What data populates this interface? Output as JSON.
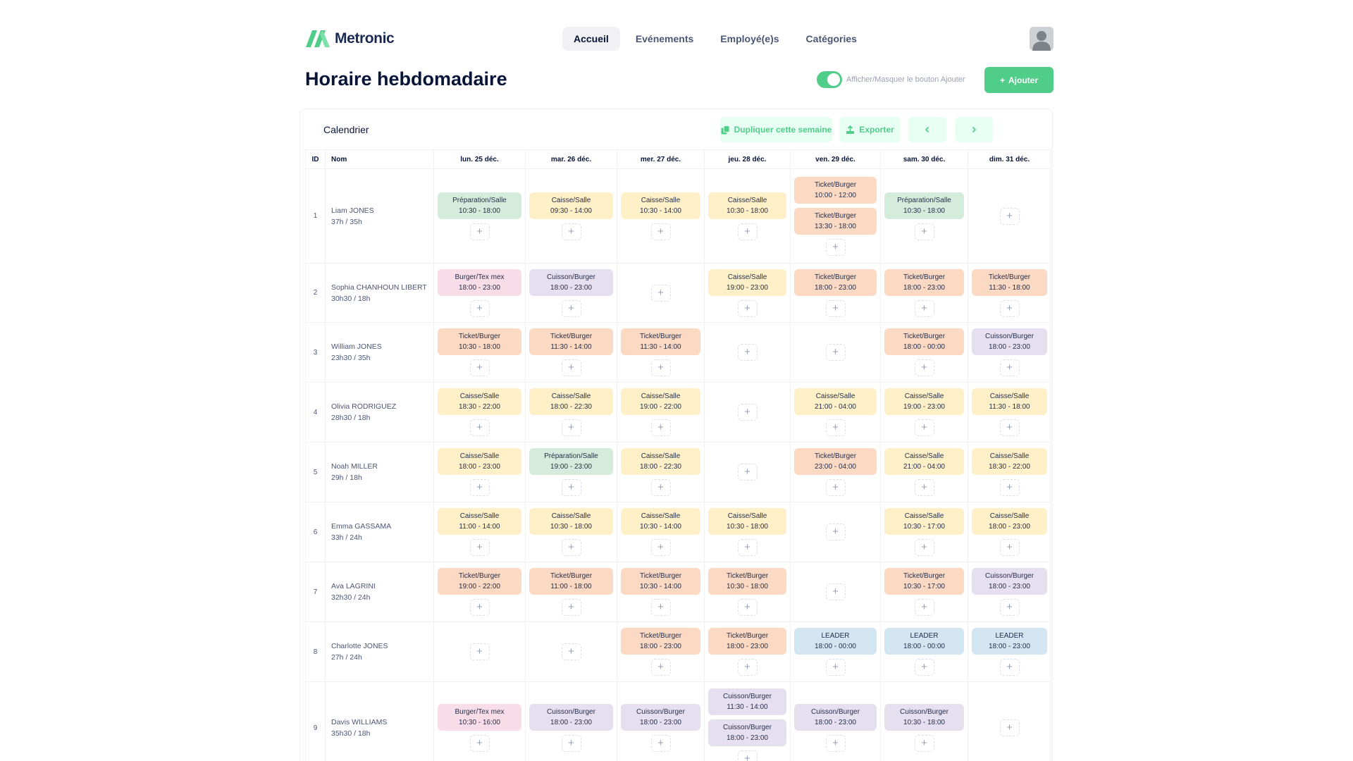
{
  "brand": {
    "name": "Metronic",
    "color": "#50cd89"
  },
  "nav": {
    "items": [
      {
        "label": "Accueil",
        "active": true
      },
      {
        "label": "Evénements",
        "active": false
      },
      {
        "label": "Employé(e)s",
        "active": false
      },
      {
        "label": "Catégories",
        "active": false
      }
    ]
  },
  "page": {
    "title": "Horaire hebdomadaire",
    "toggle_label": "Afficher/Masquer le bouton Ajouter",
    "toggle_on": true,
    "add_label": "Ajouter"
  },
  "calendar": {
    "title": "Calendrier",
    "duplicate_label": "Dupliquer cette semaine",
    "export_label": "Exporter",
    "prev_icon": "chevron-left-icon",
    "next_icon": "chevron-right-icon"
  },
  "table": {
    "col_id": "ID",
    "col_name": "Nom",
    "days": [
      "lun. 25 déc.",
      "mar. 26 déc.",
      "mer. 27 déc.",
      "jeu. 28 déc.",
      "ven. 29 déc.",
      "sam. 30 déc.",
      "dim. 31 déc."
    ],
    "rows": [
      {
        "id": "1",
        "name": "Liam JONES",
        "hours": "37h / 35h",
        "days": [
          [
            {
              "cat": "Préparation/Salle",
              "time": "10:30 - 18:00",
              "kind": "prep"
            }
          ],
          [
            {
              "cat": "Caisse/Salle",
              "time": "09:30 - 14:00",
              "kind": "caisse"
            }
          ],
          [
            {
              "cat": "Caisse/Salle",
              "time": "10:30 - 14:00",
              "kind": "caisse"
            }
          ],
          [
            {
              "cat": "Caisse/Salle",
              "time": "10:30 - 18:00",
              "kind": "caisse"
            }
          ],
          [
            {
              "cat": "Ticket/Burger",
              "time": "10:00 - 12:00",
              "kind": "ticket"
            },
            {
              "cat": "Ticket/Burger",
              "time": "13:30 - 18:00",
              "kind": "ticket"
            }
          ],
          [
            {
              "cat": "Préparation/Salle",
              "time": "10:30 - 18:00",
              "kind": "prep"
            }
          ],
          []
        ]
      },
      {
        "id": "2",
        "name": "Sophia CHANHOUN LIBERT",
        "hours": "30h30 / 18h",
        "days": [
          [
            {
              "cat": "Burger/Tex mex",
              "time": "18:00 - 23:00",
              "kind": "burgertex"
            }
          ],
          [
            {
              "cat": "Cuisson/Burger",
              "time": "18:00 - 23:00",
              "kind": "cuisson"
            }
          ],
          [],
          [
            {
              "cat": "Caisse/Salle",
              "time": "19:00 - 23:00",
              "kind": "caisse"
            }
          ],
          [
            {
              "cat": "Ticket/Burger",
              "time": "18:00 - 23:00",
              "kind": "ticket"
            }
          ],
          [
            {
              "cat": "Ticket/Burger",
              "time": "18:00 - 23:00",
              "kind": "ticket"
            }
          ],
          [
            {
              "cat": "Ticket/Burger",
              "time": "11:30 - 18:00",
              "kind": "ticket"
            }
          ]
        ]
      },
      {
        "id": "3",
        "name": "William JONES",
        "hours": "23h30 / 35h",
        "days": [
          [
            {
              "cat": "Ticket/Burger",
              "time": "10:30 - 18:00",
              "kind": "ticket"
            }
          ],
          [
            {
              "cat": "Ticket/Burger",
              "time": "11:30 - 14:00",
              "kind": "ticket"
            }
          ],
          [
            {
              "cat": "Ticket/Burger",
              "time": "11:30 - 14:00",
              "kind": "ticket"
            }
          ],
          [],
          [],
          [
            {
              "cat": "Ticket/Burger",
              "time": "18:00 - 00:00",
              "kind": "ticket"
            }
          ],
          [
            {
              "cat": "Cuisson/Burger",
              "time": "18:00 - 23:00",
              "kind": "cuisson"
            }
          ]
        ]
      },
      {
        "id": "4",
        "name": "Olivia RODRIGUEZ",
        "hours": "28h30 / 18h",
        "days": [
          [
            {
              "cat": "Caisse/Salle",
              "time": "18:30 - 22:00",
              "kind": "caisse"
            }
          ],
          [
            {
              "cat": "Caisse/Salle",
              "time": "18:00 - 22:30",
              "kind": "caisse"
            }
          ],
          [
            {
              "cat": "Caisse/Salle",
              "time": "19:00 - 22:00",
              "kind": "caisse"
            }
          ],
          [],
          [
            {
              "cat": "Caisse/Salle",
              "time": "21:00 - 04:00",
              "kind": "caisse"
            }
          ],
          [
            {
              "cat": "Caisse/Salle",
              "time": "19:00 - 23:00",
              "kind": "caisse"
            }
          ],
          [
            {
              "cat": "Caisse/Salle",
              "time": "11:30 - 18:00",
              "kind": "caisse"
            }
          ]
        ]
      },
      {
        "id": "5",
        "name": "Noah MILLER",
        "hours": "29h / 18h",
        "days": [
          [
            {
              "cat": "Caisse/Salle",
              "time": "18:00 - 23:00",
              "kind": "caisse"
            }
          ],
          [
            {
              "cat": "Préparation/Salle",
              "time": "19:00 - 23:00",
              "kind": "prep"
            }
          ],
          [
            {
              "cat": "Caisse/Salle",
              "time": "18:00 - 22:30",
              "kind": "caisse"
            }
          ],
          [],
          [
            {
              "cat": "Ticket/Burger",
              "time": "23:00 - 04:00",
              "kind": "ticket"
            }
          ],
          [
            {
              "cat": "Caisse/Salle",
              "time": "21:00 - 04:00",
              "kind": "caisse"
            }
          ],
          [
            {
              "cat": "Caisse/Salle",
              "time": "18:30 - 22:00",
              "kind": "caisse"
            }
          ]
        ]
      },
      {
        "id": "6",
        "name": "Emma GASSAMA",
        "hours": "33h / 24h",
        "days": [
          [
            {
              "cat": "Caisse/Salle",
              "time": "11:00 - 14:00",
              "kind": "caisse"
            }
          ],
          [
            {
              "cat": "Caisse/Salle",
              "time": "10:30 - 18:00",
              "kind": "caisse"
            }
          ],
          [
            {
              "cat": "Caisse/Salle",
              "time": "10:30 - 14:00",
              "kind": "caisse"
            }
          ],
          [
            {
              "cat": "Caisse/Salle",
              "time": "10:30 - 18:00",
              "kind": "caisse"
            }
          ],
          [],
          [
            {
              "cat": "Caisse/Salle",
              "time": "10:30 - 17:00",
              "kind": "caisse"
            }
          ],
          [
            {
              "cat": "Caisse/Salle",
              "time": "18:00 - 23:00",
              "kind": "caisse"
            }
          ]
        ]
      },
      {
        "id": "7",
        "name": "Ava LAGRINI",
        "hours": "32h30 / 24h",
        "days": [
          [
            {
              "cat": "Ticket/Burger",
              "time": "19:00 - 22:00",
              "kind": "ticket"
            }
          ],
          [
            {
              "cat": "Ticket/Burger",
              "time": "11:00 - 18:00",
              "kind": "ticket"
            }
          ],
          [
            {
              "cat": "Ticket/Burger",
              "time": "10:30 - 14:00",
              "kind": "ticket"
            }
          ],
          [
            {
              "cat": "Ticket/Burger",
              "time": "10:30 - 18:00",
              "kind": "ticket"
            }
          ],
          [],
          [
            {
              "cat": "Ticket/Burger",
              "time": "10:30 - 17:00",
              "kind": "ticket"
            }
          ],
          [
            {
              "cat": "Cuisson/Burger",
              "time": "18:00 - 23:00",
              "kind": "cuisson"
            }
          ]
        ]
      },
      {
        "id": "8",
        "name": "Charlotte JONES",
        "hours": "27h / 24h",
        "days": [
          [],
          [],
          [
            {
              "cat": "Ticket/Burger",
              "time": "18:00 - 23:00",
              "kind": "ticket"
            }
          ],
          [
            {
              "cat": "Ticket/Burger",
              "time": "18:00 - 23:00",
              "kind": "ticket"
            }
          ],
          [
            {
              "cat": "LEADER",
              "time": "18:00 - 00:00",
              "kind": "leader"
            }
          ],
          [
            {
              "cat": "LEADER",
              "time": "18:00 - 00:00",
              "kind": "leader"
            }
          ],
          [
            {
              "cat": "LEADER",
              "time": "18:00 - 23:00",
              "kind": "leader"
            }
          ]
        ]
      },
      {
        "id": "9",
        "name": "Davis WILLIAMS",
        "hours": "35h30 / 18h",
        "days": [
          [
            {
              "cat": "Burger/Tex mex",
              "time": "10:30 - 16:00",
              "kind": "burgertex"
            }
          ],
          [
            {
              "cat": "Cuisson/Burger",
              "time": "18:00 - 23:00",
              "kind": "cuisson"
            }
          ],
          [
            {
              "cat": "Cuisson/Burger",
              "time": "18:00 - 23:00",
              "kind": "cuisson"
            }
          ],
          [
            {
              "cat": "Cuisson/Burger",
              "time": "11:30 - 14:00",
              "kind": "cuisson"
            },
            {
              "cat": "Cuisson/Burger",
              "time": "18:00 - 23:00",
              "kind": "cuisson"
            }
          ],
          [
            {
              "cat": "Cuisson/Burger",
              "time": "18:00 - 23:00",
              "kind": "cuisson"
            }
          ],
          [
            {
              "cat": "Cuisson/Burger",
              "time": "10:30 - 18:00",
              "kind": "cuisson"
            }
          ],
          []
        ]
      }
    ]
  },
  "category_colors": {
    "prep": "#d5ecdc",
    "caisse": "#fff0c8",
    "ticket": "#fbd9c3",
    "burgertex": "#f8dde8",
    "cuisson": "#e6dff0",
    "leader": "#d3e5f1"
  }
}
